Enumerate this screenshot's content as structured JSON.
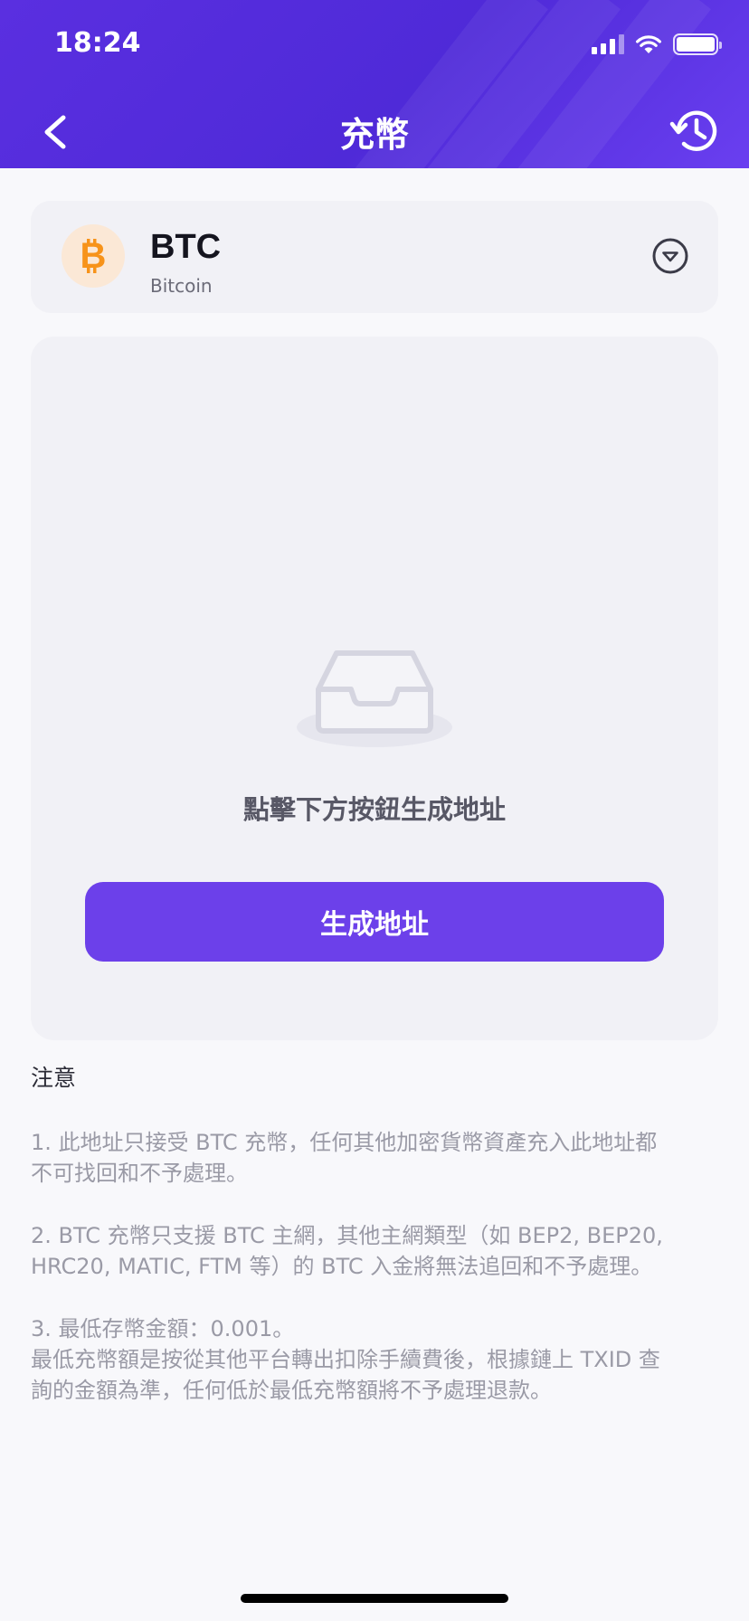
{
  "status_bar": {
    "time": "18:24"
  },
  "nav": {
    "title": "充幣",
    "back_icon": "chevron-left-icon",
    "history_icon": "history-icon"
  },
  "coin": {
    "symbol": "BTC",
    "name": "Bitcoin",
    "logo_icon": "bitcoin-icon",
    "brand_color": "#f7931a",
    "dropdown_icon": "chevron-down-circle-icon"
  },
  "address_card": {
    "empty_icon": "empty-inbox-icon",
    "empty_text": "點擊下方按鈕生成地址",
    "generate_button_label": "生成地址"
  },
  "notes": {
    "title": "注意",
    "items": [
      {
        "lines": [
          "1. 此地址只接受 BTC 充幣，任何其他加密貨幣資產充入此地址都",
          "不可找回和不予處理。"
        ]
      },
      {
        "lines": [
          "2. BTC 充幣只支援 BTC 主網，其他主網類型（如 BEP2, BEP20,",
          "HRC20, MATIC, FTM 等）的 BTC 入金將無法追回和不予處理。"
        ]
      },
      {
        "lines": [
          "3. 最低存幣金額：0.001。",
          "最低充幣額是按從其他平台轉出扣除手續費後，根據鏈上 TXID 查",
          "詢的金額為準，任何低於最低充幣額將不予處理退款。"
        ]
      }
    ]
  },
  "colors": {
    "header_gradient_start": "#5a2fe0",
    "header_gradient_end": "#6a3ff0",
    "primary_button": "#6c40ea",
    "page_background": "#f8f8fb",
    "card_background": "#f1f1f6"
  }
}
